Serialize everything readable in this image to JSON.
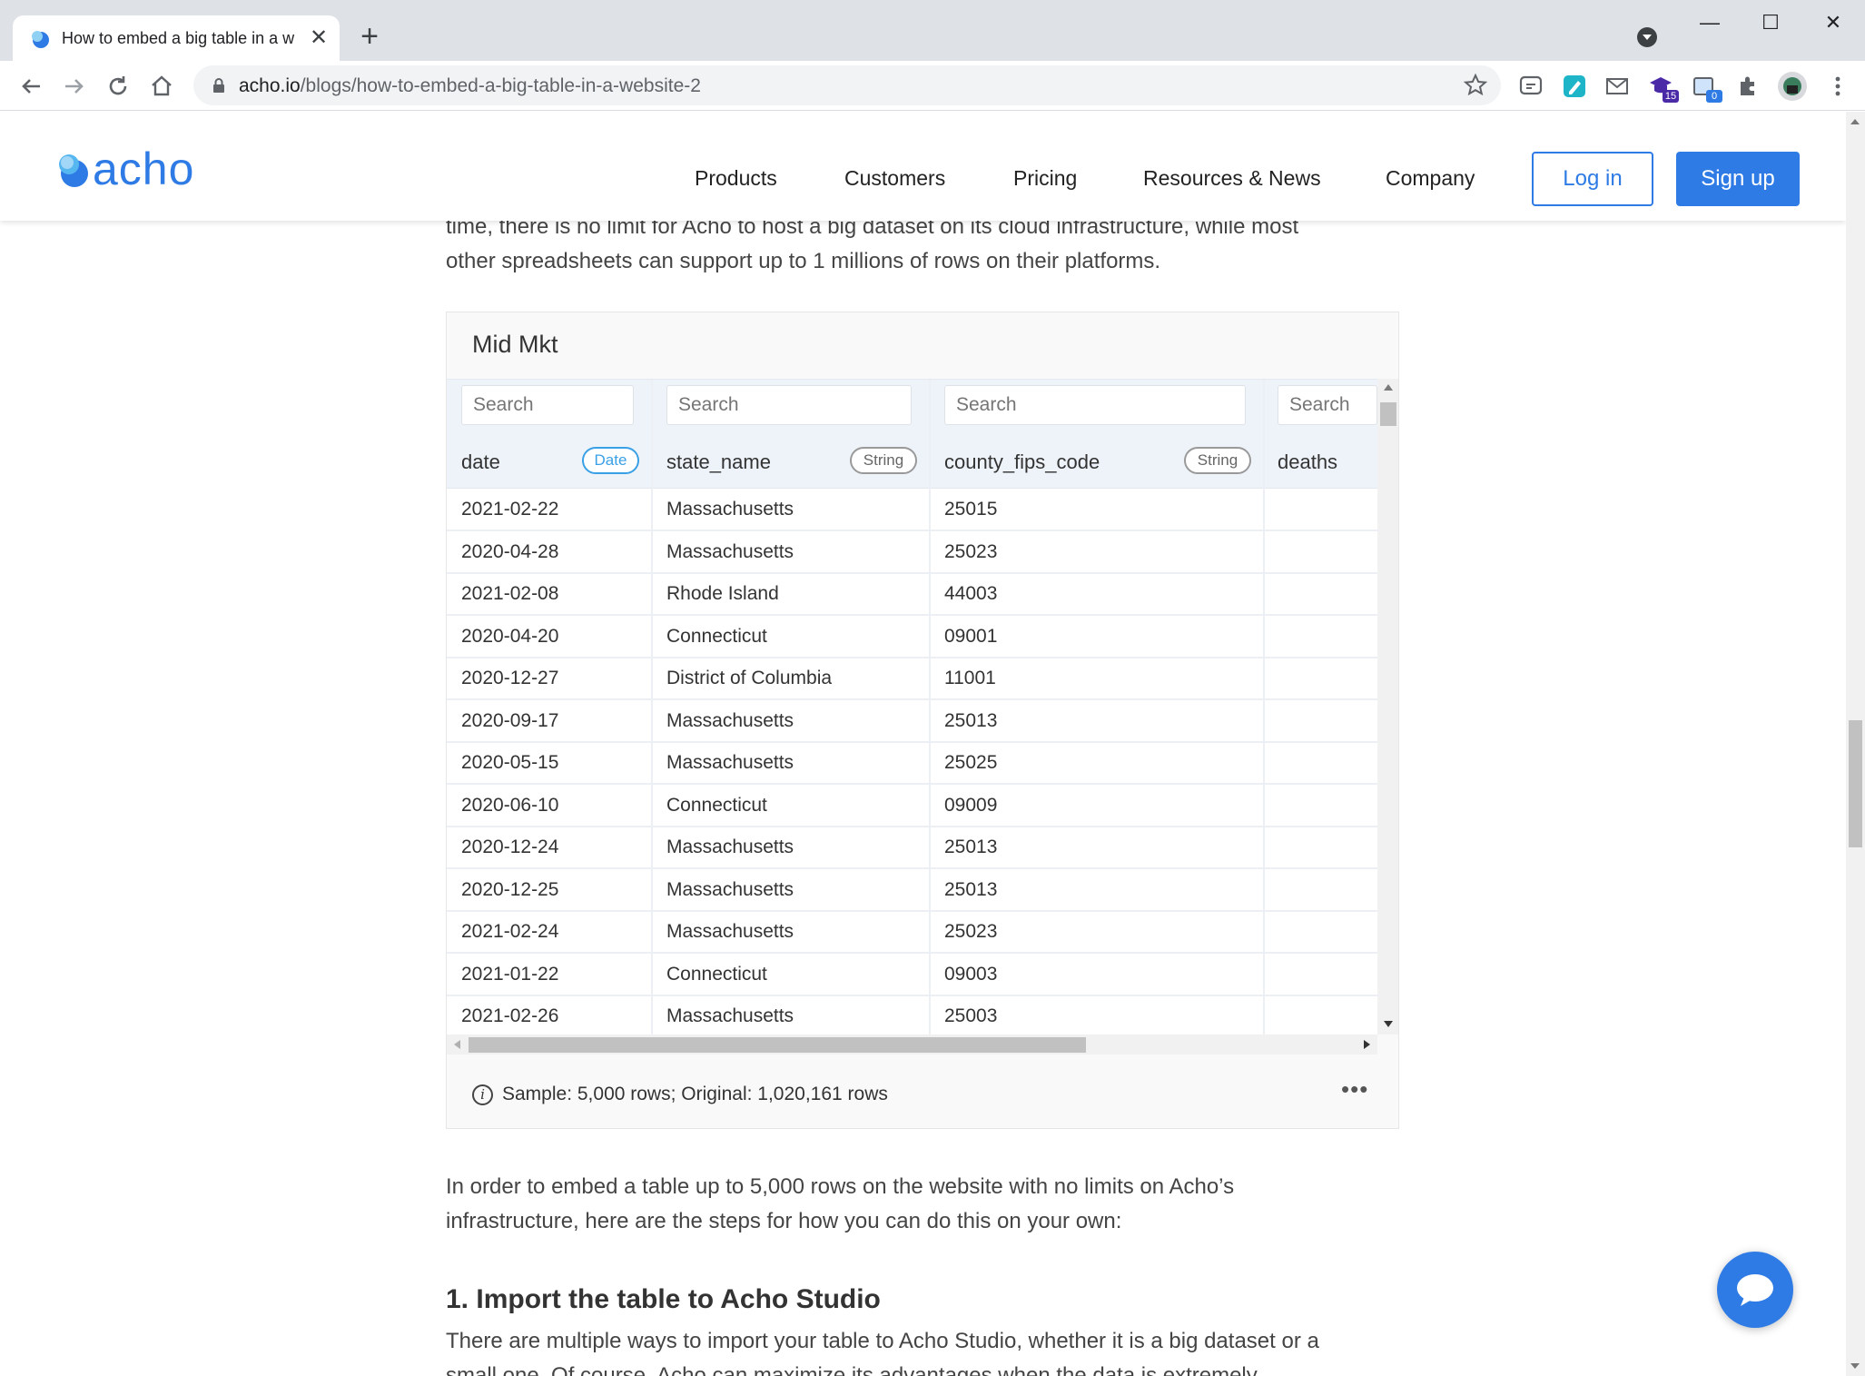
{
  "browser": {
    "tab_title": "How to embed a big table in a w",
    "url_domain": "acho.io",
    "url_path": "/blogs/how-to-embed-a-big-table-in-a-website-2",
    "extension_badges": {
      "ext_5": "15",
      "ext_6": "0"
    },
    "window_controls": {
      "minimize": "—",
      "maximize": "☐",
      "close": "✕"
    },
    "new_tab": "+",
    "tab_close": "✕"
  },
  "site": {
    "logo": "acho",
    "nav": [
      "Products",
      "Customers",
      "Pricing",
      "Resources & News",
      "Company"
    ],
    "login": "Log in",
    "signup": "Sign up"
  },
  "article": {
    "intro_line1": "time, there is no limit for Acho to host a big dataset on its cloud infrastructure, while most",
    "intro_line2": "other spreadsheets can support up to 1 millions of rows on their platforms.",
    "after_line1": "In order to embed a table up to 5,000 rows on the website with no limits on Acho’s",
    "after_line2": "infrastructure, here are the steps for how you can do this on your own:",
    "heading": "1. Import the table to Acho Studio",
    "step_line1": "There are multiple ways to import your table to Acho Studio, whether it is a big dataset or a",
    "step_line2": "small one. Of course, Acho can maximize its advantages when the data is extremely"
  },
  "table_card": {
    "title": "Mid Mkt",
    "search_placeholder": "Search",
    "columns": [
      {
        "name": "date",
        "type": "Date"
      },
      {
        "name": "state_name",
        "type": "String"
      },
      {
        "name": "county_fips_code",
        "type": "String"
      },
      {
        "name": "deaths",
        "type": ""
      }
    ],
    "rows": [
      [
        "2021-02-22",
        "Massachusetts",
        "25015",
        ""
      ],
      [
        "2020-04-28",
        "Massachusetts",
        "25023",
        ""
      ],
      [
        "2021-02-08",
        "Rhode Island",
        "44003",
        ""
      ],
      [
        "2020-04-20",
        "Connecticut",
        "09001",
        ""
      ],
      [
        "2020-12-27",
        "District of Columbia",
        "11001",
        ""
      ],
      [
        "2020-09-17",
        "Massachusetts",
        "25013",
        ""
      ],
      [
        "2020-05-15",
        "Massachusetts",
        "25025",
        ""
      ],
      [
        "2020-06-10",
        "Connecticut",
        "09009",
        ""
      ],
      [
        "2020-12-24",
        "Massachusetts",
        "25013",
        ""
      ],
      [
        "2020-12-25",
        "Massachusetts",
        "25013",
        ""
      ],
      [
        "2021-02-24",
        "Massachusetts",
        "25023",
        ""
      ],
      [
        "2021-01-22",
        "Connecticut",
        "09003",
        ""
      ],
      [
        "2021-02-26",
        "Massachusetts",
        "25003",
        ""
      ]
    ],
    "footer": "Sample: 5,000 rows; Original: 1,020,161 rows",
    "info_icon": "i",
    "more_icon": "•••"
  },
  "colors": {
    "brand": "#2f7be5",
    "date_pill": "#3aa0e6"
  }
}
